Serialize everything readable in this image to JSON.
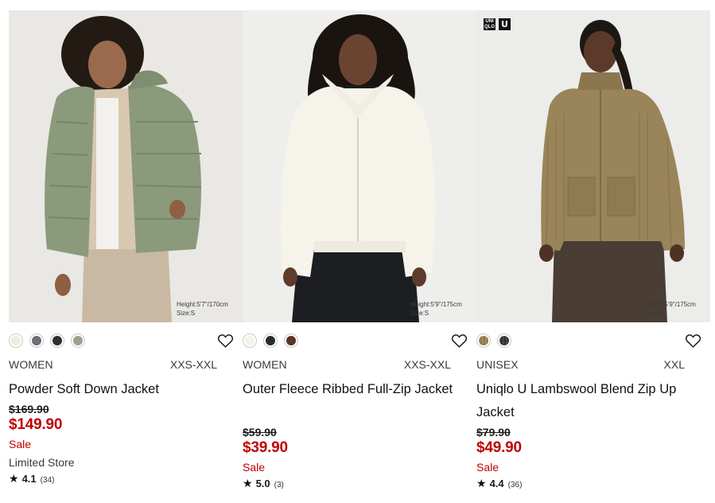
{
  "products": [
    {
      "model_height": "Height:5'7\"/170cm",
      "model_size": "Size:S",
      "swatches": [
        "#f1ece0",
        "#6d6f76",
        "#2d2f35",
        "#9aa38b"
      ],
      "gender": "WOMEN",
      "sizes": "XXS-XXL",
      "name": "Powder Soft Down Jacket",
      "old_price": "$169.90",
      "new_price": "$149.90",
      "flag": "Sale",
      "store": "Limited Store",
      "rating": "4.1",
      "reviews": "(34)"
    },
    {
      "model_height": "Height:5'9\"/175cm",
      "model_size": "Size:S",
      "swatches": [
        "#f6f2e8",
        "#2a2b2f",
        "#5a3422"
      ],
      "gender": "WOMEN",
      "sizes": "XXS-XXL",
      "name": "Outer Fleece Ribbed Full-Zip Jacket",
      "old_price": "$59.90",
      "new_price": "$39.90",
      "flag": "Sale",
      "rating": "5.0",
      "reviews": "(3)"
    },
    {
      "brand_badges": [
        "UNI QLO",
        "U"
      ],
      "model_height": "Height:5'9\"/175cm",
      "model_size": "Size:S",
      "swatches": [
        "#9c8256",
        "#3b3d42"
      ],
      "gender": "UNISEX",
      "sizes": "XXL",
      "name": "Uniqlo U Lambswool Blend Zip Up Jacket",
      "old_price": "$79.90",
      "new_price": "$49.90",
      "flag": "Sale",
      "rating": "4.4",
      "reviews": "(36)"
    }
  ],
  "icons": {
    "favorite": "heart-outline-icon",
    "rating": "star-icon"
  },
  "colors": {
    "sale_red": "#c00000",
    "text": "#1b1b1b"
  }
}
